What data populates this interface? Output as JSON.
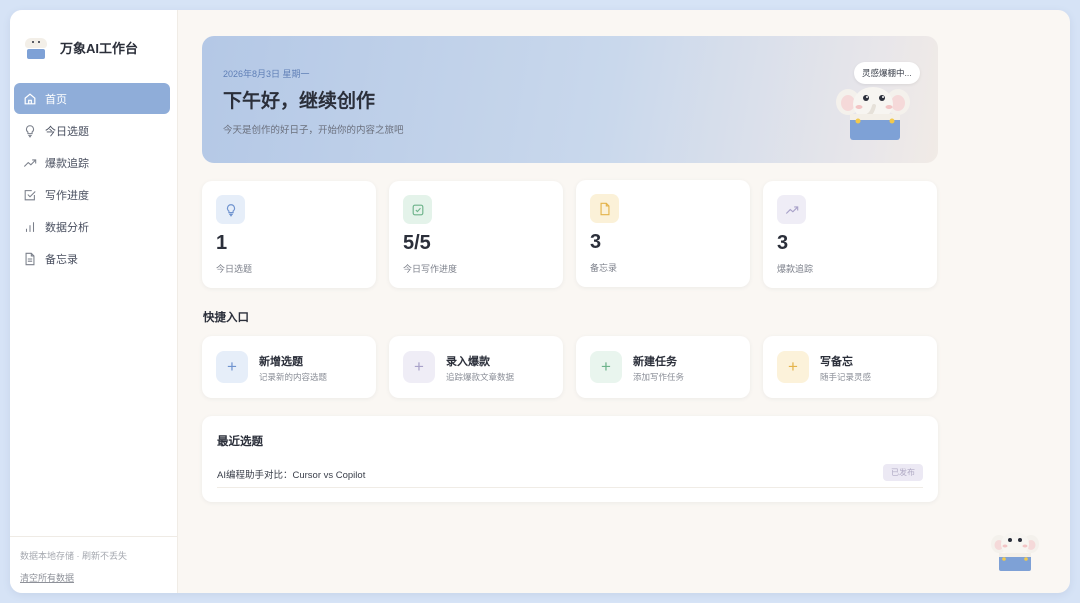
{
  "brand": {
    "title": "万象AI工作台"
  },
  "sidebar": {
    "items": [
      {
        "label": "首页",
        "icon": "home-icon",
        "active": true
      },
      {
        "label": "今日选题",
        "icon": "lightbulb-icon"
      },
      {
        "label": "爆款追踪",
        "icon": "trending-up-icon"
      },
      {
        "label": "写作进度",
        "icon": "checkbox-icon"
      },
      {
        "label": "数据分析",
        "icon": "bar-chart-icon"
      },
      {
        "label": "备忘录",
        "icon": "document-icon"
      }
    ],
    "footer_note": "数据本地存储 · 刷新不丢失",
    "clear_label": "清空所有数据"
  },
  "hero": {
    "date": "2026年8月3日 星期一",
    "greeting": "下午好，继续创作",
    "subtitle": "今天是创作的好日子，开始你的内容之旅吧",
    "bubble": "灵感爆棚中..."
  },
  "stats": [
    {
      "value": "1",
      "label": "今日选题",
      "icon": "lightbulb-icon",
      "color": "#6f93cf",
      "bg": "#e6eef9"
    },
    {
      "value": "5/5",
      "label": "今日写作进度",
      "icon": "checkbox-icon",
      "color": "#6db38a",
      "bg": "#e4f3ea"
    },
    {
      "value": "3",
      "label": "备忘录",
      "icon": "document-icon",
      "color": "#e4b34a",
      "bg": "#fbf1d8"
    },
    {
      "value": "3",
      "label": "爆款追踪",
      "icon": "trending-up-icon",
      "color": "#a9a2c9",
      "bg": "#efedf6"
    }
  ],
  "quick": {
    "title": "快捷入口",
    "items": [
      {
        "title": "新增选题",
        "subtitle": "记录新的内容选题",
        "color": "#6f93cf",
        "bg": "#e6eef9"
      },
      {
        "title": "录入爆款",
        "subtitle": "追踪爆款文章数据",
        "color": "#a9a2c9",
        "bg": "#efedf6"
      },
      {
        "title": "新建任务",
        "subtitle": "添加写作任务",
        "color": "#6db38a",
        "bg": "#e9f5ee"
      },
      {
        "title": "写备忘",
        "subtitle": "随手记录灵感",
        "color": "#e4b34a",
        "bg": "#fcf2da"
      }
    ]
  },
  "recent": {
    "title": "最近选题",
    "rows": [
      {
        "title": "AI编程助手对比：Cursor vs Copilot",
        "status": "已发布"
      }
    ]
  }
}
